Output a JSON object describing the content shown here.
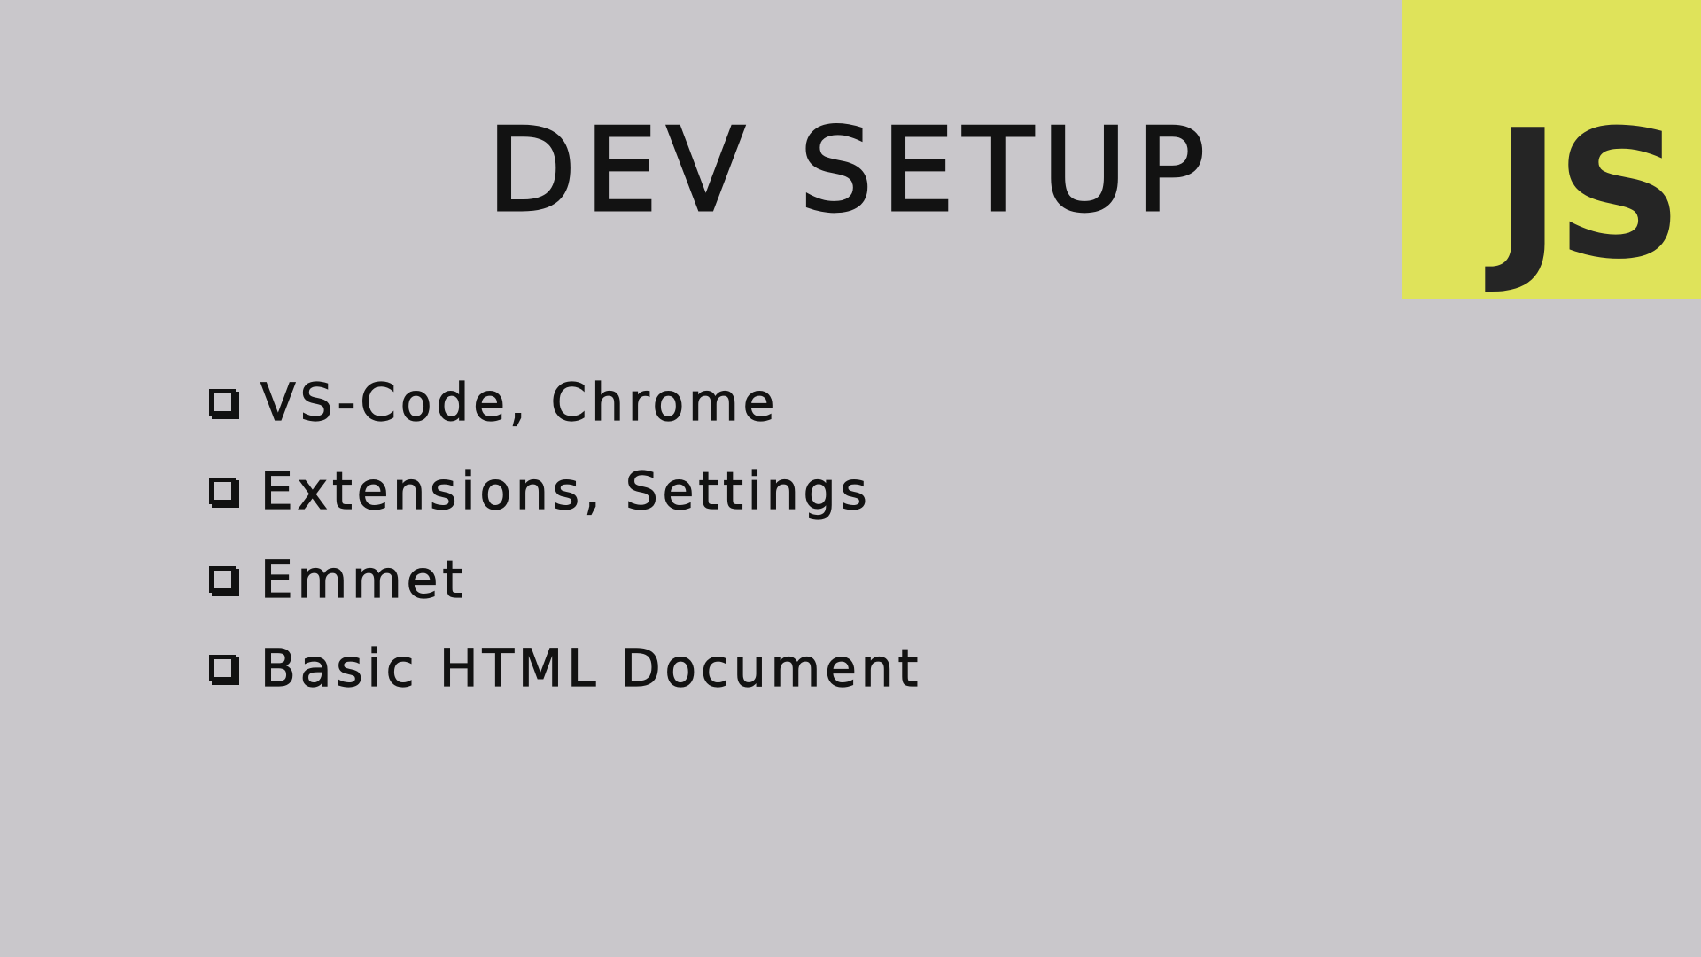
{
  "slide": {
    "title": "DEV SETUP",
    "logo": {
      "text": "JS",
      "background_color": "#dfe35a",
      "text_color": "#252525"
    },
    "checklist": [
      {
        "label": "VS-Code, Chrome",
        "icon": "checkbox-icon"
      },
      {
        "label": "Extensions, Settings",
        "icon": "checkbox-icon"
      },
      {
        "label": "Emmet",
        "icon": "checkbox-icon"
      },
      {
        "label": "Basic HTML Document",
        "icon": "checkbox-icon"
      }
    ],
    "background_color": "#c9c7cb"
  }
}
